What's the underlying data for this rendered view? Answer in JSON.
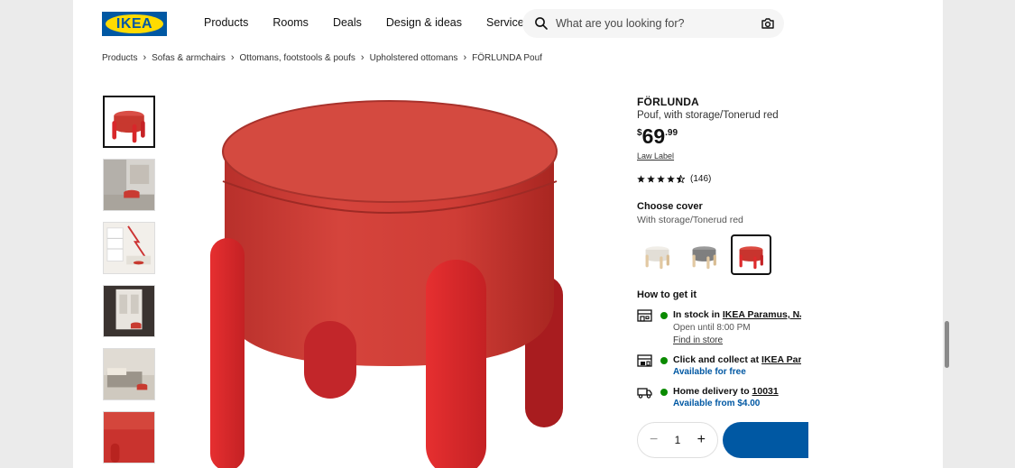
{
  "brand": {
    "logo_text": "IKEA"
  },
  "nav": [
    {
      "label": "Products"
    },
    {
      "label": "Rooms"
    },
    {
      "label": "Deals"
    },
    {
      "label": "Design & ideas"
    },
    {
      "label": "Services"
    }
  ],
  "search": {
    "placeholder": "What are you looking for?",
    "icon": "search-icon",
    "camera_icon": "camera-icon"
  },
  "breadcrumb": [
    "Products",
    "Sofas & armchairs",
    "Ottomans, footstools & poufs",
    "Upholstered ottomans",
    "FÖRLUNDA Pouf"
  ],
  "product": {
    "name": "FÖRLUNDA",
    "description": "Pouf, with storage/Tonerud red",
    "price_currency": "$",
    "price_integer": "69",
    "price_decimal": ".99",
    "law_label": "Law Label",
    "rating_stars": 4.5,
    "review_count": "(146)"
  },
  "cover": {
    "title": "Choose cover",
    "selected": "With storage/Tonerud red",
    "options": [
      {
        "name": "white",
        "color": "#e9e6df"
      },
      {
        "name": "grey",
        "color": "#8c8c8c"
      },
      {
        "name": "red",
        "color": "#d8343a"
      }
    ]
  },
  "availability": {
    "title": "How to get it",
    "store": {
      "prefix": "In stock in ",
      "store_name": "IKEA Paramus, NJ",
      "open": "Open until 8:00 PM",
      "link": "Find in store"
    },
    "collect": {
      "prefix": "Click and collect at ",
      "store_name": "IKEA Paramus, NJ",
      "status": "Available for free"
    },
    "delivery": {
      "prefix": "Home delivery to ",
      "zip": "10031",
      "status": "Available from $4.00"
    }
  },
  "quantity": {
    "value": "1",
    "minus": "−",
    "plus": "+"
  },
  "colors": {
    "ikea_blue": "#0058a3",
    "ikea_yellow": "#ffdb00",
    "stock_green": "#0a8a00",
    "product_red": "#c9302c"
  }
}
